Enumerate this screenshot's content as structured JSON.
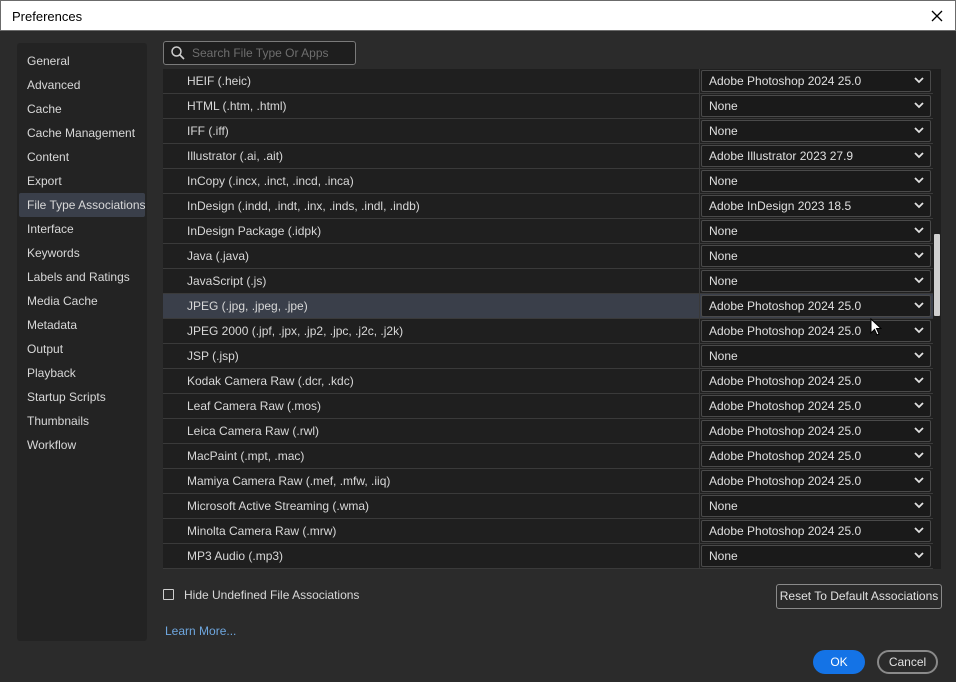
{
  "window": {
    "title": "Preferences"
  },
  "sidebar": {
    "items": [
      {
        "label": "General"
      },
      {
        "label": "Advanced"
      },
      {
        "label": "Cache"
      },
      {
        "label": "Cache Management"
      },
      {
        "label": "Content"
      },
      {
        "label": "Export"
      },
      {
        "label": "File Type Associations",
        "selected": true
      },
      {
        "label": "Interface"
      },
      {
        "label": "Keywords"
      },
      {
        "label": "Labels and Ratings"
      },
      {
        "label": "Media Cache"
      },
      {
        "label": "Metadata"
      },
      {
        "label": "Output"
      },
      {
        "label": "Playback"
      },
      {
        "label": "Startup Scripts"
      },
      {
        "label": "Thumbnails"
      },
      {
        "label": "Workflow"
      }
    ]
  },
  "search": {
    "placeholder": "Search File Type Or Apps",
    "value": ""
  },
  "associations": {
    "rows": [
      {
        "file_type": "HEIF (.heic)",
        "app": "Adobe Photoshop 2024 25.0"
      },
      {
        "file_type": "HTML (.htm, .html)",
        "app": "None"
      },
      {
        "file_type": "IFF (.iff)",
        "app": "None"
      },
      {
        "file_type": "Illustrator (.ai, .ait)",
        "app": "Adobe Illustrator 2023 27.9"
      },
      {
        "file_type": "InCopy (.incx, .inct, .incd, .inca)",
        "app": "None"
      },
      {
        "file_type": "InDesign (.indd, .indt, .inx, .inds, .indl, .indb)",
        "app": "Adobe InDesign 2023 18.5"
      },
      {
        "file_type": "InDesign Package (.idpk)",
        "app": "None"
      },
      {
        "file_type": "Java (.java)",
        "app": "None"
      },
      {
        "file_type": "JavaScript (.js)",
        "app": "None"
      },
      {
        "file_type": "JPEG (.jpg, .jpeg, .jpe)",
        "app": "Adobe Photoshop 2024 25.0",
        "selected": true
      },
      {
        "file_type": "JPEG 2000 (.jpf, .jpx, .jp2, .jpc, .j2c, .j2k)",
        "app": "Adobe Photoshop 2024 25.0"
      },
      {
        "file_type": "JSP (.jsp)",
        "app": "None"
      },
      {
        "file_type": "Kodak Camera Raw (.dcr, .kdc)",
        "app": "Adobe Photoshop 2024 25.0"
      },
      {
        "file_type": "Leaf Camera Raw (.mos)",
        "app": "Adobe Photoshop 2024 25.0"
      },
      {
        "file_type": "Leica Camera Raw (.rwl)",
        "app": "Adobe Photoshop 2024 25.0"
      },
      {
        "file_type": "MacPaint (.mpt, .mac)",
        "app": "Adobe Photoshop 2024 25.0"
      },
      {
        "file_type": "Mamiya Camera Raw (.mef, .mfw, .iiq)",
        "app": "Adobe Photoshop 2024 25.0"
      },
      {
        "file_type": "Microsoft Active Streaming (.wma)",
        "app": "None"
      },
      {
        "file_type": "Minolta Camera Raw (.mrw)",
        "app": "Adobe Photoshop 2024 25.0"
      },
      {
        "file_type": "MP3 Audio (.mp3)",
        "app": "None"
      }
    ]
  },
  "footer": {
    "hide_undefined_label": "Hide Undefined File Associations",
    "hide_undefined_checked": false,
    "reset_label": "Reset To Default Associations",
    "learn_more_label": "Learn More...",
    "ok_label": "OK",
    "cancel_label": "Cancel"
  },
  "colors": {
    "accent": "#1473e6",
    "link": "#6ea6de",
    "selection": "#3a3f4a",
    "background": "#2b2b2b"
  }
}
